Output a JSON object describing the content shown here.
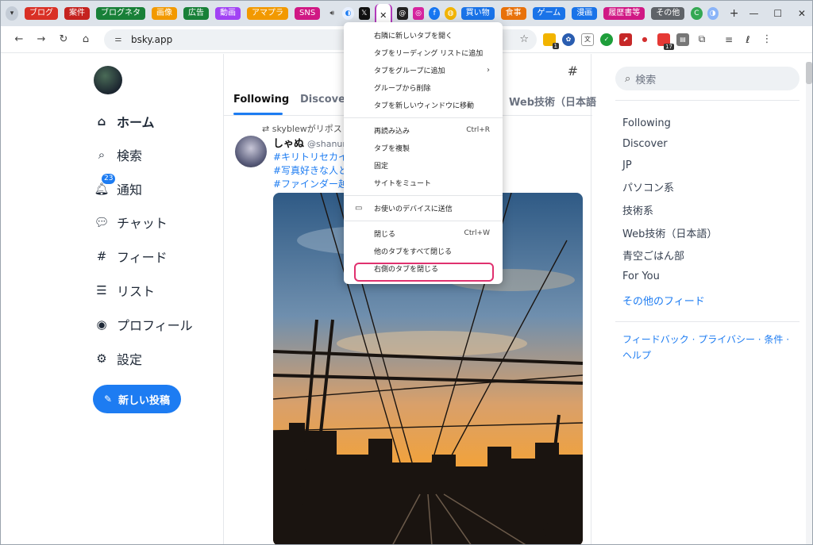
{
  "browser": {
    "tab_groups": [
      {
        "label": "ブログ",
        "color": "#d93025"
      },
      {
        "label": "案件",
        "color": "#c5221f"
      },
      {
        "label": "ブログネタ",
        "color": "#188038"
      },
      {
        "label": "画像",
        "color": "#f29900"
      },
      {
        "label": "広告",
        "color": "#188038"
      },
      {
        "label": "動画",
        "color": "#a142f4"
      },
      {
        "label": "アマプラ",
        "color": "#f29900"
      },
      {
        "label": "SNS",
        "color": "#d01884"
      }
    ],
    "right_groups": [
      {
        "label": "買い物",
        "color": "#1a73e8"
      },
      {
        "label": "食事",
        "color": "#e8710a"
      },
      {
        "label": "ゲーム",
        "color": "#1a73e8"
      },
      {
        "label": "漫画",
        "color": "#1a73e8"
      },
      {
        "label": "履歴書等",
        "color": "#d01884"
      },
      {
        "label": "その他",
        "color": "#5f6368"
      }
    ],
    "active_tab_close": "✕",
    "new_tab": "+",
    "window_controls": {
      "minimize": "—",
      "maximize": "☐",
      "close": "✕"
    },
    "url": "bsky.app",
    "extension_badges": {
      "first": "1",
      "second": "17"
    }
  },
  "sidebar": {
    "items": [
      {
        "label": "ホーム",
        "icon": "home-icon",
        "glyph": "⌂"
      },
      {
        "label": "検索",
        "icon": "search-icon",
        "glyph": "⌕"
      },
      {
        "label": "通知",
        "icon": "bell-icon",
        "glyph": "🔔︎",
        "badge": "23"
      },
      {
        "label": "チャット",
        "icon": "chat-icon",
        "glyph": "💬︎"
      },
      {
        "label": "フィード",
        "icon": "hash-icon",
        "glyph": "#"
      },
      {
        "label": "リスト",
        "icon": "list-icon",
        "glyph": "☰"
      },
      {
        "label": "プロフィール",
        "icon": "profile-icon",
        "glyph": "◉"
      },
      {
        "label": "設定",
        "icon": "gear-icon",
        "glyph": "⚙"
      }
    ],
    "new_post": "新しい投稿"
  },
  "feed": {
    "tabs": [
      "Following",
      "Discover",
      "Web技術（日本語"
    ],
    "active_tab": "Following",
    "post": {
      "repost_text": "skyblewがリポス",
      "author": "しゃぬ",
      "handle": "@shanun",
      "hashtags": [
        "#キリトリセカイ",
        "#写真好きな人と",
        "#ファインダー越"
      ]
    }
  },
  "right": {
    "search_placeholder": "検索",
    "feeds": [
      "Following",
      "Discover",
      "JP",
      "パソコン系",
      "技術系",
      "Web技術（日本語）",
      "青空ごはん部",
      "For You"
    ],
    "more_feeds": "その他のフィード",
    "footer": "フィードバック · プライバシー · 条件 · ヘルプ"
  },
  "context_menu": {
    "group1": [
      "右隣に新しいタブを開く",
      "タブをリーディング リストに追加",
      "タブをグループに追加",
      "グループから削除",
      "タブを新しいウィンドウに移動"
    ],
    "group2": [
      {
        "label": "再読み込み",
        "shortcut": "Ctrl+R"
      },
      {
        "label": "タブを複製",
        "shortcut": ""
      },
      {
        "label": "固定",
        "shortcut": ""
      },
      {
        "label": "サイトをミュート",
        "shortcut": ""
      }
    ],
    "send_to_device": "お使いのデバイスに送信",
    "group4": [
      {
        "label": "閉じる",
        "shortcut": "Ctrl+W"
      },
      {
        "label": "他のタブをすべて閉じる",
        "shortcut": ""
      },
      {
        "label": "右側のタブを閉じる",
        "shortcut": ""
      }
    ],
    "submenu_arrow": "›",
    "highlight_color": "#e0316f"
  }
}
